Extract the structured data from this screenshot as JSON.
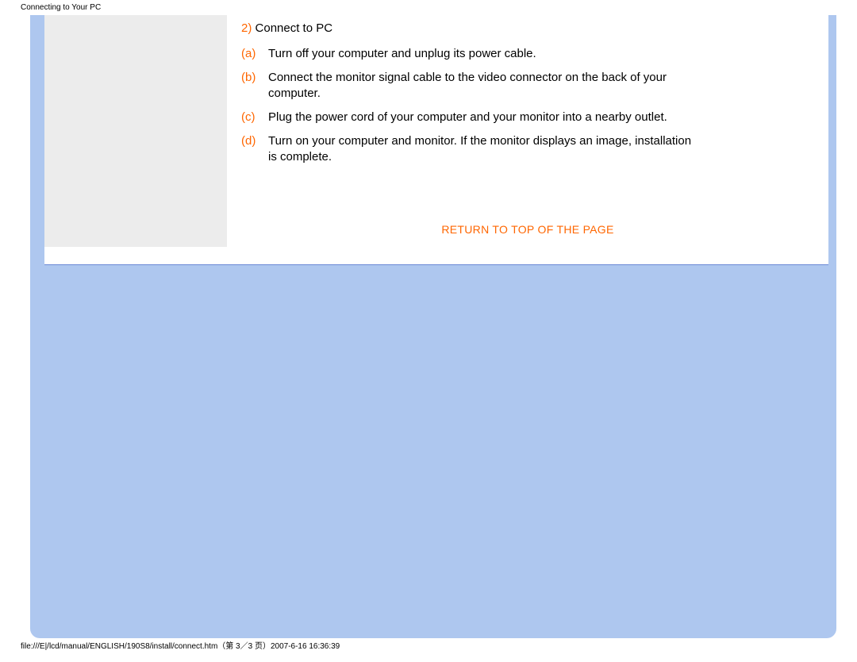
{
  "header": {
    "title": "Connecting to Your PC"
  },
  "section": {
    "number": "2)",
    "title": "Connect to PC",
    "steps": [
      {
        "letter": "(a)",
        "text": "Turn off your computer and unplug its power cable."
      },
      {
        "letter": "(b)",
        "text": "Connect the monitor signal cable to the video connector on the back of your computer."
      },
      {
        "letter": "(c)",
        "text": "Plug the power cord of your computer and your monitor into a nearby outlet."
      },
      {
        "letter": "(d)",
        "text": "Turn on your computer and monitor. If the monitor displays an image, installation is complete."
      }
    ]
  },
  "links": {
    "return_top": "RETURN TO TOP OF THE PAGE"
  },
  "footer": {
    "text": "file:///E|/lcd/manual/ENGLISH/190S8/install/connect.htm（第 3／3 页）2007-6-16 16:36:39"
  }
}
